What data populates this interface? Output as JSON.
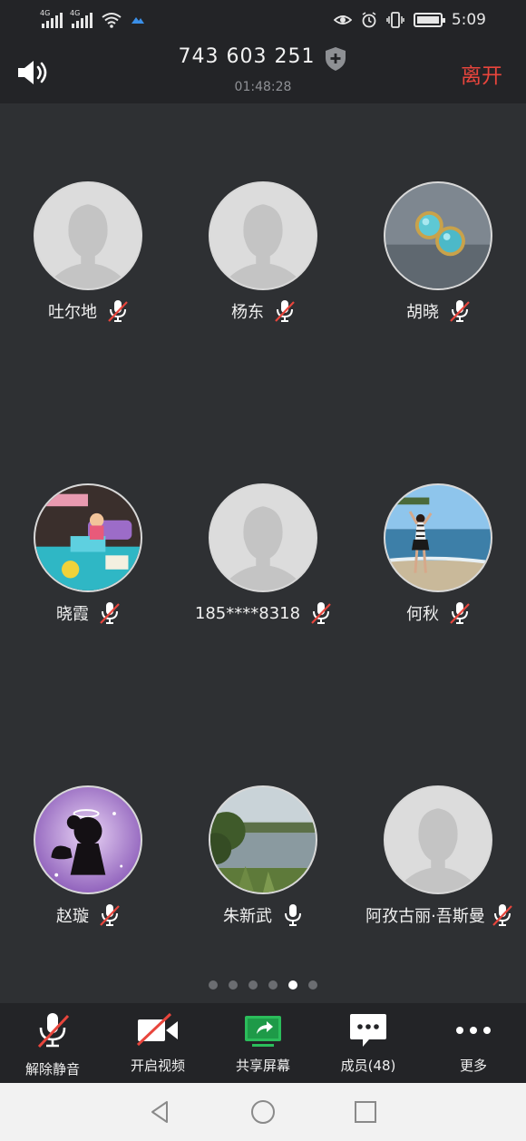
{
  "status_bar": {
    "sim1": "4G",
    "sim2": "4G",
    "time": "5:09"
  },
  "header": {
    "meeting_id": "743 603 251",
    "duration": "01:48:28",
    "leave_label": "离开"
  },
  "participants": [
    {
      "name": "吐尔地",
      "avatar": "default",
      "muted": true
    },
    {
      "name": "杨东",
      "avatar": "default",
      "muted": true
    },
    {
      "name": "胡晓",
      "avatar": "earrings-photo",
      "muted": true
    },
    {
      "name": "晓霞",
      "avatar": "toy-house-photo",
      "muted": true
    },
    {
      "name": "185****8318",
      "avatar": "default",
      "muted": true
    },
    {
      "name": "何秋",
      "avatar": "beach-photo",
      "muted": true
    },
    {
      "name": "赵璇",
      "avatar": "angel-silhouette-photo",
      "muted": true
    },
    {
      "name": "朱新武",
      "avatar": "lake-photo",
      "muted": false
    },
    {
      "name": "阿孜古丽·吾斯曼",
      "avatar": "default",
      "muted": true
    }
  ],
  "pagination": {
    "total": 6,
    "active": 5
  },
  "toolbar": {
    "unmute_label": "解除静音",
    "video_label": "开启视频",
    "share_label": "共享屏幕",
    "members_label": "成员(48)",
    "more_label": "更多"
  },
  "colors": {
    "leave": "#e8453c",
    "share_accent": "#2bbd5b",
    "muted_slash": "#e8453c"
  }
}
